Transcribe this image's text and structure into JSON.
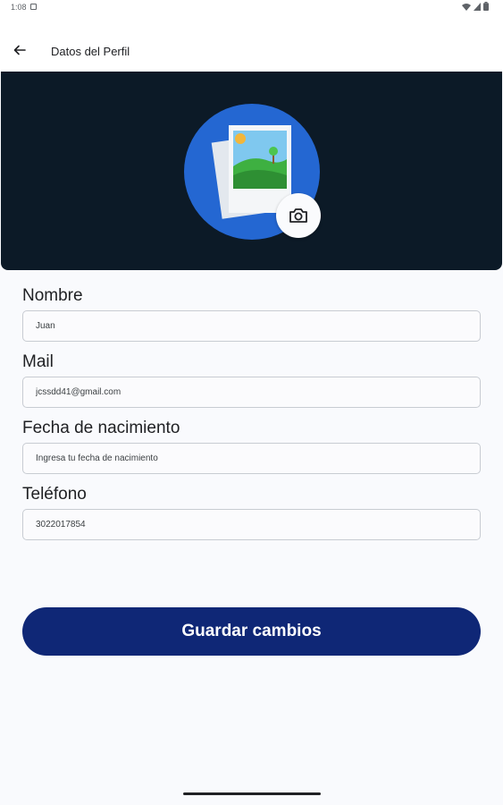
{
  "status_bar": {
    "time": "1:08",
    "notif_icon": "square-notification-icon",
    "wifi_icon": "wifi-icon",
    "battery_icon": "battery-icon"
  },
  "app_bar": {
    "title": "Datos del Perfil",
    "back_icon": "arrow-back-icon"
  },
  "profile": {
    "avatar_icon": "image-placeholder-icon",
    "avatar_bg": "#2467d2",
    "camera_icon": "camera-icon"
  },
  "form": {
    "name_label": "Nombre",
    "name_value": "Juan",
    "mail_label": "Mail",
    "mail_value": "jcssdd41@gmail.com",
    "birth_label": "Fecha de nacimiento",
    "birth_placeholder": "Ingresa tu fecha de nacimiento",
    "phone_label": "Teléfono",
    "phone_value": "3022017854"
  },
  "actions": {
    "save_label": "Guardar cambios",
    "save_color": "#0f2776"
  },
  "colors": {
    "header_bg": "#0c1a27",
    "page_bg": "#f9fafd"
  }
}
